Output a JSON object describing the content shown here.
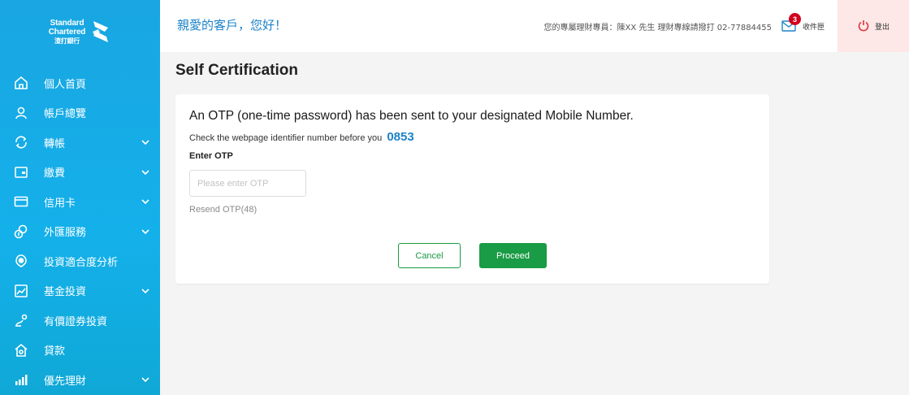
{
  "brand": {
    "line1": "Standard",
    "line2": "Chartered",
    "line3": "渣打銀行"
  },
  "sidebar": {
    "items": [
      {
        "label": "個人首頁",
        "icon": "home-icon",
        "has_submenu": false
      },
      {
        "label": "帳戶總覽",
        "icon": "user-icon",
        "has_submenu": false
      },
      {
        "label": "轉帳",
        "icon": "transfer-icon",
        "has_submenu": true
      },
      {
        "label": "繳費",
        "icon": "wallet-icon",
        "has_submenu": true
      },
      {
        "label": "信用卡",
        "icon": "credit-card-icon",
        "has_submenu": true
      },
      {
        "label": "外匯服務",
        "icon": "fx-icon",
        "has_submenu": true
      },
      {
        "label": "投資適合度分析",
        "icon": "target-icon",
        "has_submenu": false
      },
      {
        "label": "基金投資",
        "icon": "fund-icon",
        "has_submenu": true
      },
      {
        "label": "有價證券投資",
        "icon": "securities-icon",
        "has_submenu": false
      },
      {
        "label": "貸款",
        "icon": "loan-house-icon",
        "has_submenu": false
      },
      {
        "label": "優先理財",
        "icon": "priority-chart-icon",
        "has_submenu": true
      }
    ]
  },
  "header": {
    "greeting": "親愛的客戶，您好！",
    "advisor_text": "您的專屬理財專員：陳XX 先生 理財專線請撥打 02-77884455",
    "inbox_label": "收件匣",
    "inbox_count": "3",
    "logout_label": "登出"
  },
  "main": {
    "title": "Self Certification",
    "otp_message": "An OTP (one-time password) has been sent to your designated Mobile Number.",
    "identifier_text": "Check the webpage identifier number before you",
    "identifier_code": "0853",
    "enter_otp_label": "Enter OTP",
    "otp_placeholder": "Please enter OTP",
    "otp_value": "",
    "resend_label": "Resend OTP(48)",
    "cancel_label": "Cancel",
    "proceed_label": "Proceed"
  },
  "colors": {
    "sidebar_bg": "#19a6e2",
    "accent_blue": "#1c83c8",
    "primary_green": "#1a9b45",
    "badge_red": "#d0021b",
    "logout_bg": "#fde7e7"
  }
}
